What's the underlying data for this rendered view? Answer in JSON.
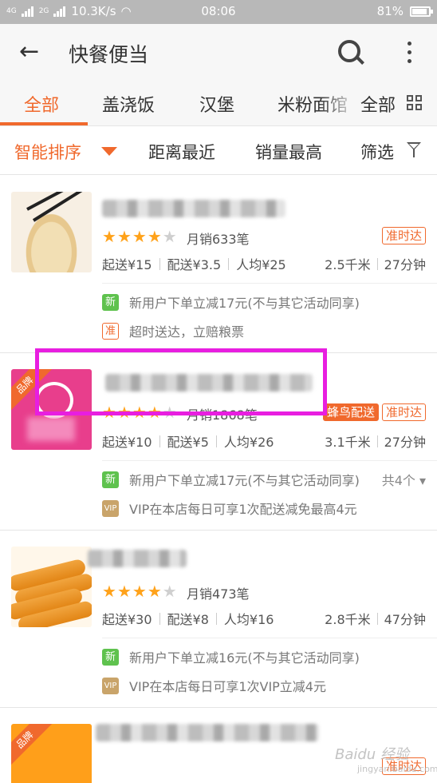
{
  "status_bar": {
    "network": "4G",
    "network2": "2G",
    "speed": "10.3K/s",
    "time": "08:06",
    "battery": "81%"
  },
  "app_bar": {
    "title": "快餐便当"
  },
  "tabs": {
    "items": [
      "全部",
      "盖浇饭",
      "汉堡",
      "米粉面馆"
    ],
    "active_index": 0,
    "all_label": "全部"
  },
  "sort_bar": {
    "items": [
      "智能排序",
      "距离最近",
      "销量最高",
      "筛选"
    ],
    "active_index": 0
  },
  "colors": {
    "accent": "#f0692d",
    "star": "#ffa21a",
    "new_green": "#5fc24e",
    "highlight": "#e81ee0"
  },
  "restaurants": [
    {
      "rating": 4,
      "sales": "月销633笔",
      "badges": [
        "准时达"
      ],
      "min_order": "起送¥15",
      "delivery_fee": "配送¥3.5",
      "per_person": "人均¥25",
      "distance": "2.5千米",
      "time": "27分钟",
      "promos": [
        {
          "icon": "新",
          "icon_style": "green",
          "text": "新用户下单立减17元(不与其它活动同享)"
        },
        {
          "icon": "准",
          "icon_style": "orange",
          "text": "超时送达，立赔粮票"
        }
      ]
    },
    {
      "rating": 4,
      "sales": "月销1868笔",
      "brand": "品牌",
      "badges": [
        "蜂鸟配送",
        "准时达"
      ],
      "min_order": "起送¥10",
      "delivery_fee": "配送¥5",
      "per_person": "人均¥26",
      "distance": "3.1千米",
      "time": "27分钟",
      "promos": [
        {
          "icon": "新",
          "icon_style": "green",
          "text": "新用户下单立减17元(不与其它活动同享)",
          "more": "共4个 ▾"
        },
        {
          "icon": "VIP",
          "icon_style": "vip",
          "text": "VIP在本店每日可享1次配送减免最高4元"
        }
      ]
    },
    {
      "rating": 4,
      "sales": "月销473笔",
      "badges": [],
      "min_order": "起送¥30",
      "delivery_fee": "配送¥8",
      "per_person": "人均¥16",
      "distance": "2.8千米",
      "time": "47分钟",
      "promos": [
        {
          "icon": "新",
          "icon_style": "green",
          "text": "新用户下单立减16元(不与其它活动同享)"
        },
        {
          "icon": "VIP",
          "icon_style": "vip",
          "text": "VIP在本店每日可享1次VIP立减4元"
        }
      ]
    },
    {
      "brand": "品牌",
      "badges": [
        "准时达"
      ]
    }
  ],
  "watermark": {
    "text": "Baidu 经验",
    "sub": "jingyan.baidu.com"
  }
}
